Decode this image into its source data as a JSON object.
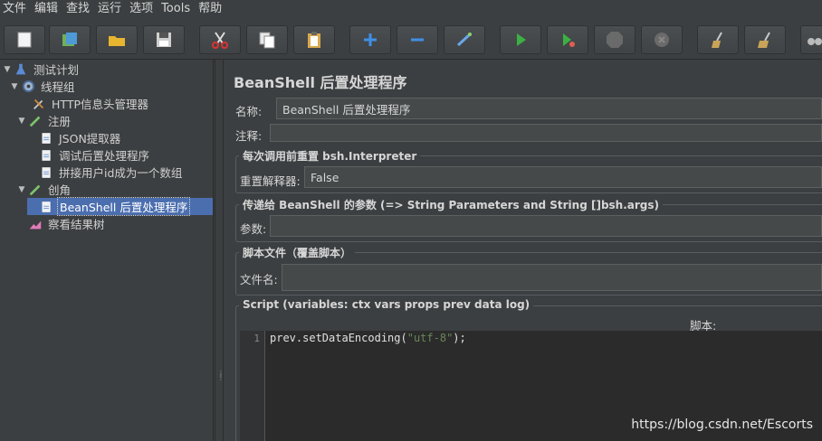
{
  "menu": [
    "文件",
    "编辑",
    "查找",
    "运行",
    "选项",
    "Tools",
    "帮助"
  ],
  "toolbar": [
    "new",
    "templates",
    "open",
    "save",
    "cut",
    "copy",
    "paste",
    "expand",
    "collapse",
    "toggle",
    "start",
    "start-no-pauses",
    "stop",
    "shutdown",
    "clear",
    "clear-all",
    "search"
  ],
  "tree": {
    "items": [
      {
        "label": "测试计划",
        "icon": "test-plan-icon"
      },
      {
        "label": "线程组",
        "icon": "thread-group-icon"
      },
      {
        "label": "HTTP信息头管理器",
        "icon": "header-manager-icon"
      },
      {
        "label": "注册",
        "icon": "sampler-icon"
      },
      {
        "label": "JSON提取器",
        "icon": "post-processor-icon"
      },
      {
        "label": "调试后置处理程序",
        "icon": "post-processor-icon"
      },
      {
        "label": "拼接用户id成为一个数组",
        "icon": "post-processor-icon"
      },
      {
        "label": "创角",
        "icon": "sampler-icon"
      },
      {
        "label": "BeanShell 后置处理程序",
        "icon": "post-processor-icon"
      },
      {
        "label": "察看结果树",
        "icon": "listener-icon"
      }
    ]
  },
  "panel": {
    "title": "BeanShell 后置处理程序",
    "name_label": "名称:",
    "name_value": "BeanShell 后置处理程序",
    "comment_label": "注释:",
    "comment_value": "",
    "reset_group": "每次调用前重置 bsh.Interpreter",
    "reset_label": "重置解释器:",
    "reset_value": "False",
    "params_group": "传递给 BeanShell 的参数 (=> String Parameters and String []bsh.args)",
    "params_label": "参数:",
    "params_value": "",
    "file_group": "脚本文件（覆盖脚本）",
    "file_label": "文件名:",
    "file_value": "",
    "script_group": "Script (variables: ctx vars props prev data log)",
    "script_label": "脚本:",
    "line_no": "1",
    "code_prefix": "prev.setDataEncoding(",
    "code_string": "\"utf-8\"",
    "code_suffix": ");"
  },
  "watermark": "https://blog.csdn.net/Escorts"
}
